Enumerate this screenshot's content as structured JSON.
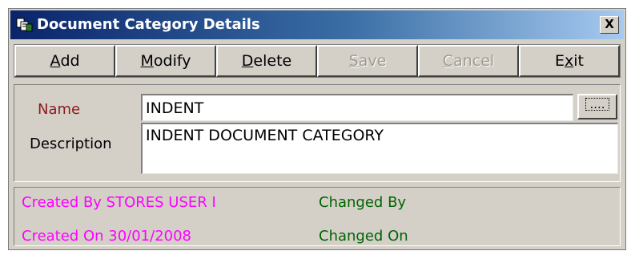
{
  "window": {
    "title": "Document Category Details",
    "close_label": "X"
  },
  "toolbar": {
    "buttons": [
      {
        "pre": "",
        "key": "A",
        "post": "dd",
        "enabled": true
      },
      {
        "pre": "",
        "key": "M",
        "post": "odify",
        "enabled": true
      },
      {
        "pre": "",
        "key": "D",
        "post": "elete",
        "enabled": true
      },
      {
        "pre": "",
        "key": "S",
        "post": "ave",
        "enabled": false
      },
      {
        "pre": "",
        "key": "C",
        "post": "ancel",
        "enabled": false
      },
      {
        "pre": "E",
        "key": "x",
        "post": "it",
        "enabled": true
      }
    ]
  },
  "form": {
    "name_label": "Name",
    "name_value": "INDENT",
    "lookup_label": "....",
    "description_label": "Description",
    "description_value": "INDENT DOCUMENT CATEGORY"
  },
  "audit": {
    "created_by": "Created By STORES USER I",
    "created_on": "Created On 30/01/2008",
    "changed_by": "Changed By",
    "changed_on": "Changed On"
  },
  "colors": {
    "titlebar_start": "#0a246a",
    "titlebar_end": "#a6caf0",
    "window_bg": "#d4d0c8",
    "name_label": "#8b1a1a",
    "created_text": "#ff00ff",
    "changed_text": "#006400"
  }
}
